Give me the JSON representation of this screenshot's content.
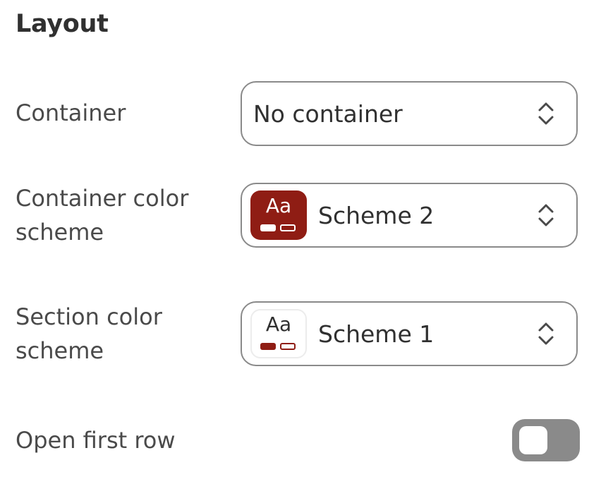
{
  "section": {
    "title": "Layout"
  },
  "container": {
    "label": "Container",
    "value": "No container"
  },
  "container_color_scheme": {
    "label_line1": "Container color",
    "label_line2": "scheme",
    "value": "Scheme 2",
    "swatch_text": "Aa",
    "swatch_bg": "#8f1d14",
    "swatch_fg": "#ffffff"
  },
  "section_color_scheme": {
    "label_line1": "Section color",
    "label_line2": "scheme",
    "value": "Scheme 1",
    "swatch_text": "Aa",
    "swatch_bg": "#ffffff",
    "swatch_fg": "#8f1d14"
  },
  "open_first_row": {
    "label": "Open first row",
    "checked": false,
    "icon": "toggle-off-icon"
  },
  "icons": {
    "select_arrows": "chevron-up-down-icon"
  }
}
